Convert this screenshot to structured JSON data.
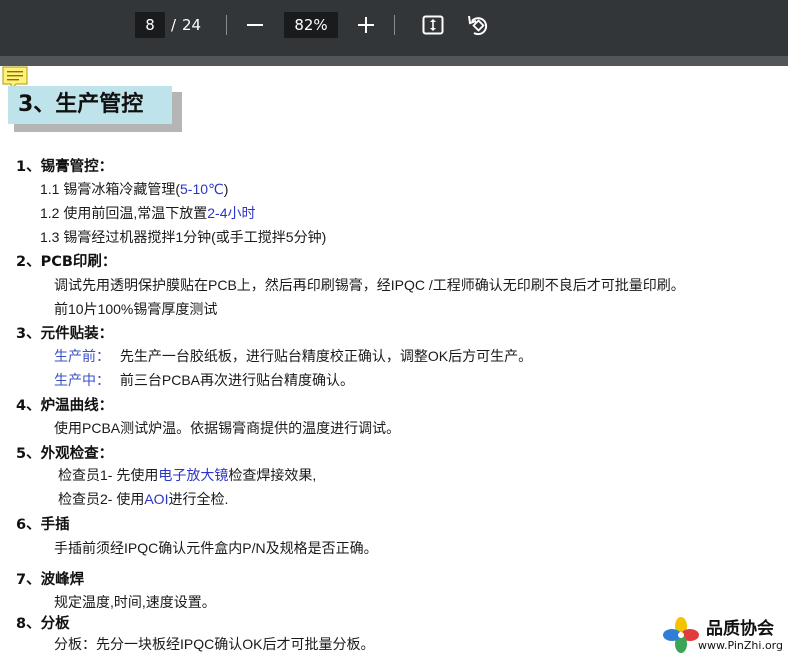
{
  "toolbar": {
    "page_current": "8",
    "page_separator": "/",
    "page_total": "24",
    "zoom_value": "82%",
    "icons": [
      "zoom-out-icon",
      "zoom-in-icon",
      "fit-page-icon",
      "rotate-icon"
    ]
  },
  "document": {
    "heading": "3、生产管控",
    "sections": [
      {
        "title": "1、锡膏管控：",
        "lines": [
          {
            "parts": [
              "1.1 锡膏冰箱冷藏管理(",
              "5-10℃",
              ")"
            ]
          },
          {
            "parts": [
              "1.2 使用前回温,常温下放置",
              "2-4小时",
              ""
            ]
          },
          {
            "parts": [
              "1.3 锡膏经过机器搅拌1分钟(或手工搅拌5分钟)"
            ]
          }
        ]
      },
      {
        "title": "2、PCB印刷：",
        "lines": [
          {
            "parts": [
              "调试先用透明保护膜贴在PCB上，然后再印刷锡膏，经IPQC /工程师确认无印刷不良后才可批量印刷。"
            ]
          },
          {
            "parts": [
              "前10片100%锡膏厚度测试"
            ]
          }
        ]
      },
      {
        "title": "3、元件贴装：",
        "lines": [
          {
            "parts": [
              "生产前：",
              "先生产一台胶纸板，进行贴台精度校正确认，调整OK后方可生产。"
            ]
          },
          {
            "parts": [
              "生产中：",
              "前三台PCBA再次进行贴台精度确认。"
            ]
          }
        ]
      },
      {
        "title": "4、炉温曲线：",
        "lines": [
          {
            "parts": [
              "使用PCBA测试炉温。依据锡膏商提供的温度进行调试。"
            ]
          }
        ]
      },
      {
        "title": "5、外观检查：",
        "lines": [
          {
            "parts": [
              "检查员1- 先使用",
              "电子放大镜",
              "检查焊接效果,"
            ]
          },
          {
            "parts": [
              "检查员2- 使用",
              "AOI",
              "进行全检."
            ]
          }
        ]
      },
      {
        "title": "6、手插",
        "lines": [
          {
            "parts": [
              "手插前须经IPQC确认元件盒内P/N及规格是否正确。"
            ]
          }
        ]
      },
      {
        "title": "7、波峰焊",
        "lines": [
          {
            "parts": [
              "规定温度,时间,速度设置。"
            ]
          }
        ]
      },
      {
        "title": "8、分板",
        "lines": [
          {
            "parts": [
              "分板：先分一块板经IPQC确认OK后才可批量分板。"
            ]
          }
        ]
      }
    ]
  },
  "watermark": {
    "title": "品质协会",
    "url": "www.PinZhi.org"
  },
  "colors": {
    "toolbar_bg": "#323639",
    "heading_bg": "#bfe3ea",
    "highlight_blue": "#2b35c8"
  }
}
